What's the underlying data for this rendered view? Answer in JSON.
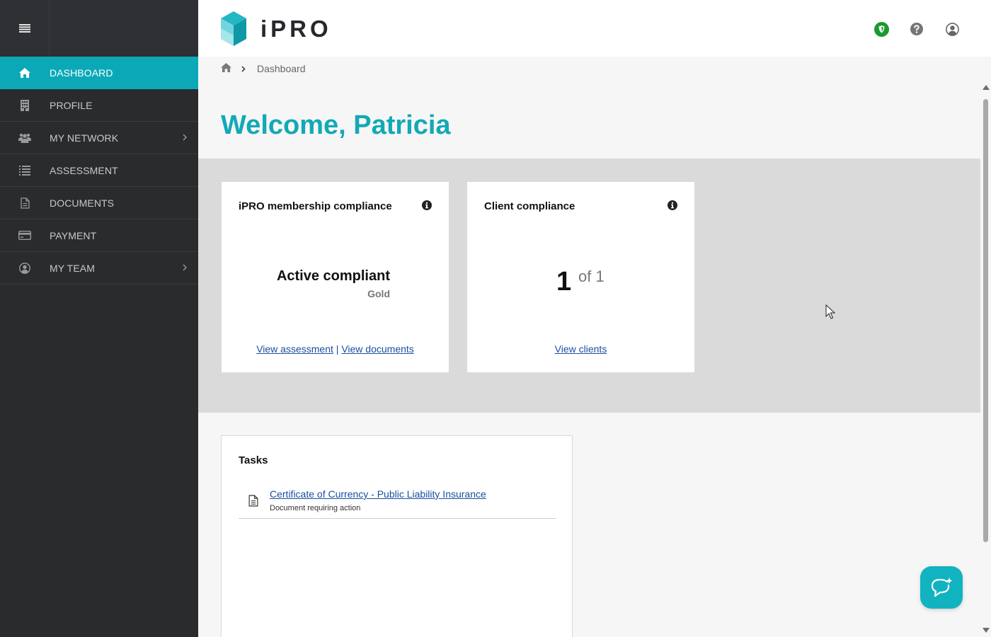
{
  "brand": {
    "name": "iPRO",
    "accent": "#0ba9b8"
  },
  "sidebar": {
    "items": [
      {
        "label": "DASHBOARD",
        "icon": "home-icon",
        "active": true
      },
      {
        "label": "PROFILE",
        "icon": "building-icon"
      },
      {
        "label": "MY NETWORK",
        "icon": "users-icon",
        "has_submenu": true
      },
      {
        "label": "ASSESSMENT",
        "icon": "list-icon"
      },
      {
        "label": "DOCUMENTS",
        "icon": "document-icon"
      },
      {
        "label": "PAYMENT",
        "icon": "credit-card-icon"
      },
      {
        "label": "MY TEAM",
        "icon": "user-circle-icon",
        "has_submenu": true
      }
    ]
  },
  "header": {
    "icons": [
      "shield-status-icon",
      "help-icon",
      "account-icon"
    ],
    "status_color": "#1a9a2f"
  },
  "breadcrumb": {
    "current": "Dashboard"
  },
  "welcome": "Welcome, Patricia",
  "membership": {
    "title": "iPRO membership compliance",
    "status": "Active compliant",
    "level": "Gold",
    "link_assessment": "View assessment",
    "link_separator": "|",
    "link_documents": "View documents"
  },
  "client": {
    "title": "Client compliance",
    "count": "1",
    "total": "of 1",
    "link_clients": "View clients"
  },
  "tasks": {
    "title": "Tasks",
    "items": [
      {
        "label": "Certificate of Currency - Public Liability Insurance",
        "subtitle": "Document requiring action"
      }
    ]
  }
}
